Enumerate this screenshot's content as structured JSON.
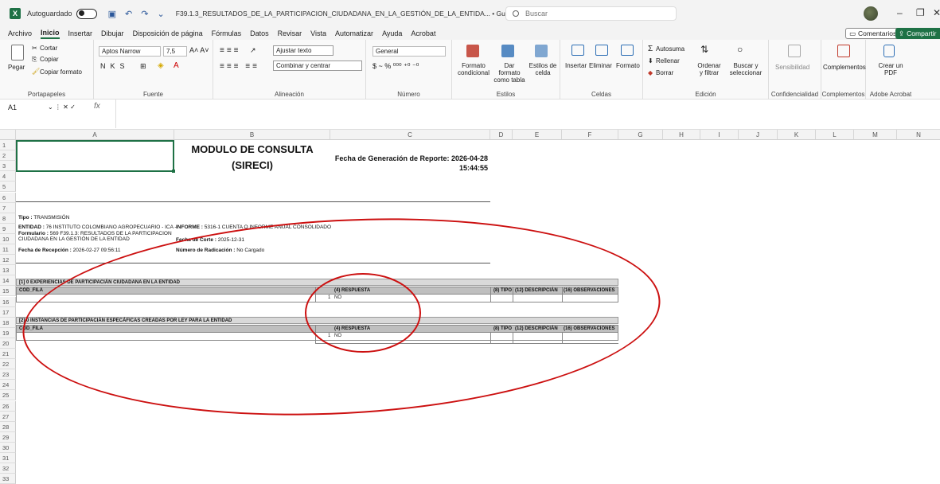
{
  "titlebar": {
    "autosave_label": "Autoguardado",
    "toggle_label": "",
    "doc_title": "F39.1.3_RESULTADOS_DE_LA_PARTICIPACION_CIUDADANA_EN_LA_GESTIÓN_DE_LA_ENTIDA... • Guardado en Este PC ∨",
    "search_placeholder": "Buscar"
  },
  "menu": [
    "Archivo",
    "Inicio",
    "Insertar",
    "Dibujar",
    "Disposición de página",
    "Fórmulas",
    "Datos",
    "Revisar",
    "Vista",
    "Automatizar",
    "Ayuda",
    "Acrobat"
  ],
  "actions": {
    "comments": "Comentarios",
    "share": "Compartir"
  },
  "ribbon": {
    "clipboard": {
      "paste": "Pegar",
      "cut": "Cortar",
      "copy": "Copiar",
      "format": "Copiar formato",
      "label": "Portapapeles"
    },
    "font": {
      "name": "Aptos Narrow",
      "size": "7,5",
      "label": "Fuente"
    },
    "alignment": {
      "wrap": "Ajustar texto",
      "merge": "Combinar y centrar",
      "label": "Alineación"
    },
    "number": {
      "format": "General",
      "label": "Número"
    },
    "styles": {
      "cond": "Formato condicional",
      "table": "Dar formato como tabla",
      "cell": "Estilos de celda",
      "label": "Estilos"
    },
    "cells": {
      "insert": "Insertar",
      "delete": "Eliminar",
      "format": "Formato",
      "label": "Celdas"
    },
    "editing": {
      "autosum": "Autosuma",
      "fill": "Rellenar",
      "clear": "Borrar",
      "sort": "Ordenar y filtrar",
      "find": "Buscar y seleccionar",
      "label": "Edición"
    },
    "sensitivity": {
      "btn": "Sensibilidad",
      "label": "Confidencialidad"
    },
    "addins": {
      "btn": "Complementos",
      "label": "Complementos"
    },
    "acrobat": {
      "btn": "Crear un PDF",
      "label": "Adobe Acrobat"
    }
  },
  "formula": {
    "namebox": "A1",
    "fx": "fx"
  },
  "columns": [
    "A",
    "B",
    "C",
    "D",
    "E",
    "F",
    "G",
    "H",
    "I",
    "J",
    "K",
    "L",
    "M",
    "N"
  ],
  "rows": [
    "1",
    "2",
    "3",
    "4",
    "5",
    "6",
    "7",
    "8",
    "9",
    "10",
    "11",
    "12",
    "13",
    "14",
    "15",
    "16",
    "17",
    "18",
    "19",
    "20",
    "21",
    "22",
    "23",
    "24",
    "25",
    "26",
    "27",
    "28",
    "29",
    "30",
    "31",
    "32",
    "33"
  ],
  "report": {
    "title_line1": "MODULO DE CONSULTA",
    "title_line2": "(SIRECI)",
    "fecha_label": "Fecha de Generación de Reporte: 2026-04-28",
    "fecha_time": "15:44:55",
    "tipo_label": "Tipo :",
    "tipo_value": "TRANSMISIÓN",
    "entidad_label": "ENTIDAD :",
    "entidad_value": "76 INSTITUTO COLOMBIANO AGROPECUARIO - ICA -",
    "informe_label": "INFORME :",
    "informe_value": "5316-1 CUENTA O INFORME ANUAL CONSOLIDADO",
    "formulario_label": "Formulario :",
    "formulario_value1": "569 F39.1.3: RESULTADOS DE LA PARTICIPACION",
    "formulario_value2": "CIUDADANA EN LA GESTIÓN DE LA ENTIDAD",
    "corte_label": "Fecha de Corte :",
    "corte_value": "2025-12-31",
    "recepcion_label": "Fecha de Recepción :",
    "recepcion_value": "2026-02-27 09:56:11",
    "radicacion_label": "Número de Radicación :",
    "radicacion_value": "No Cargado"
  },
  "section1": {
    "title": "[1] 0 EXPERIENCIAS DE PARTICIPACIÁN CIUDADANA EN LA ENTIDAD",
    "headers": [
      "COD_FILA",
      "(4) RESPUESTA",
      "(8) TIPO",
      "(12) DESCRIPCIÁN",
      "(16) OBSERVACIONES"
    ],
    "row": {
      "cod": "1",
      "respuesta": "NO"
    }
  },
  "section2": {
    "title": "[2] 0 INSTANCIAS DE PARTICIPACIÁN ESPECÁFICAS CREADAS POR LEY PARA LA ENTIDAD",
    "headers": [
      "COD_FILA",
      "(4) RESPUESTA",
      "(8) TIPO",
      "(12) DESCRIPCIÁN",
      "(16) OBSERVACIONES"
    ],
    "row": {
      "cod": "1",
      "respuesta": "NO"
    }
  },
  "colors": {
    "excel_green": "#1e7145",
    "annotation_red": "#cc1010"
  }
}
